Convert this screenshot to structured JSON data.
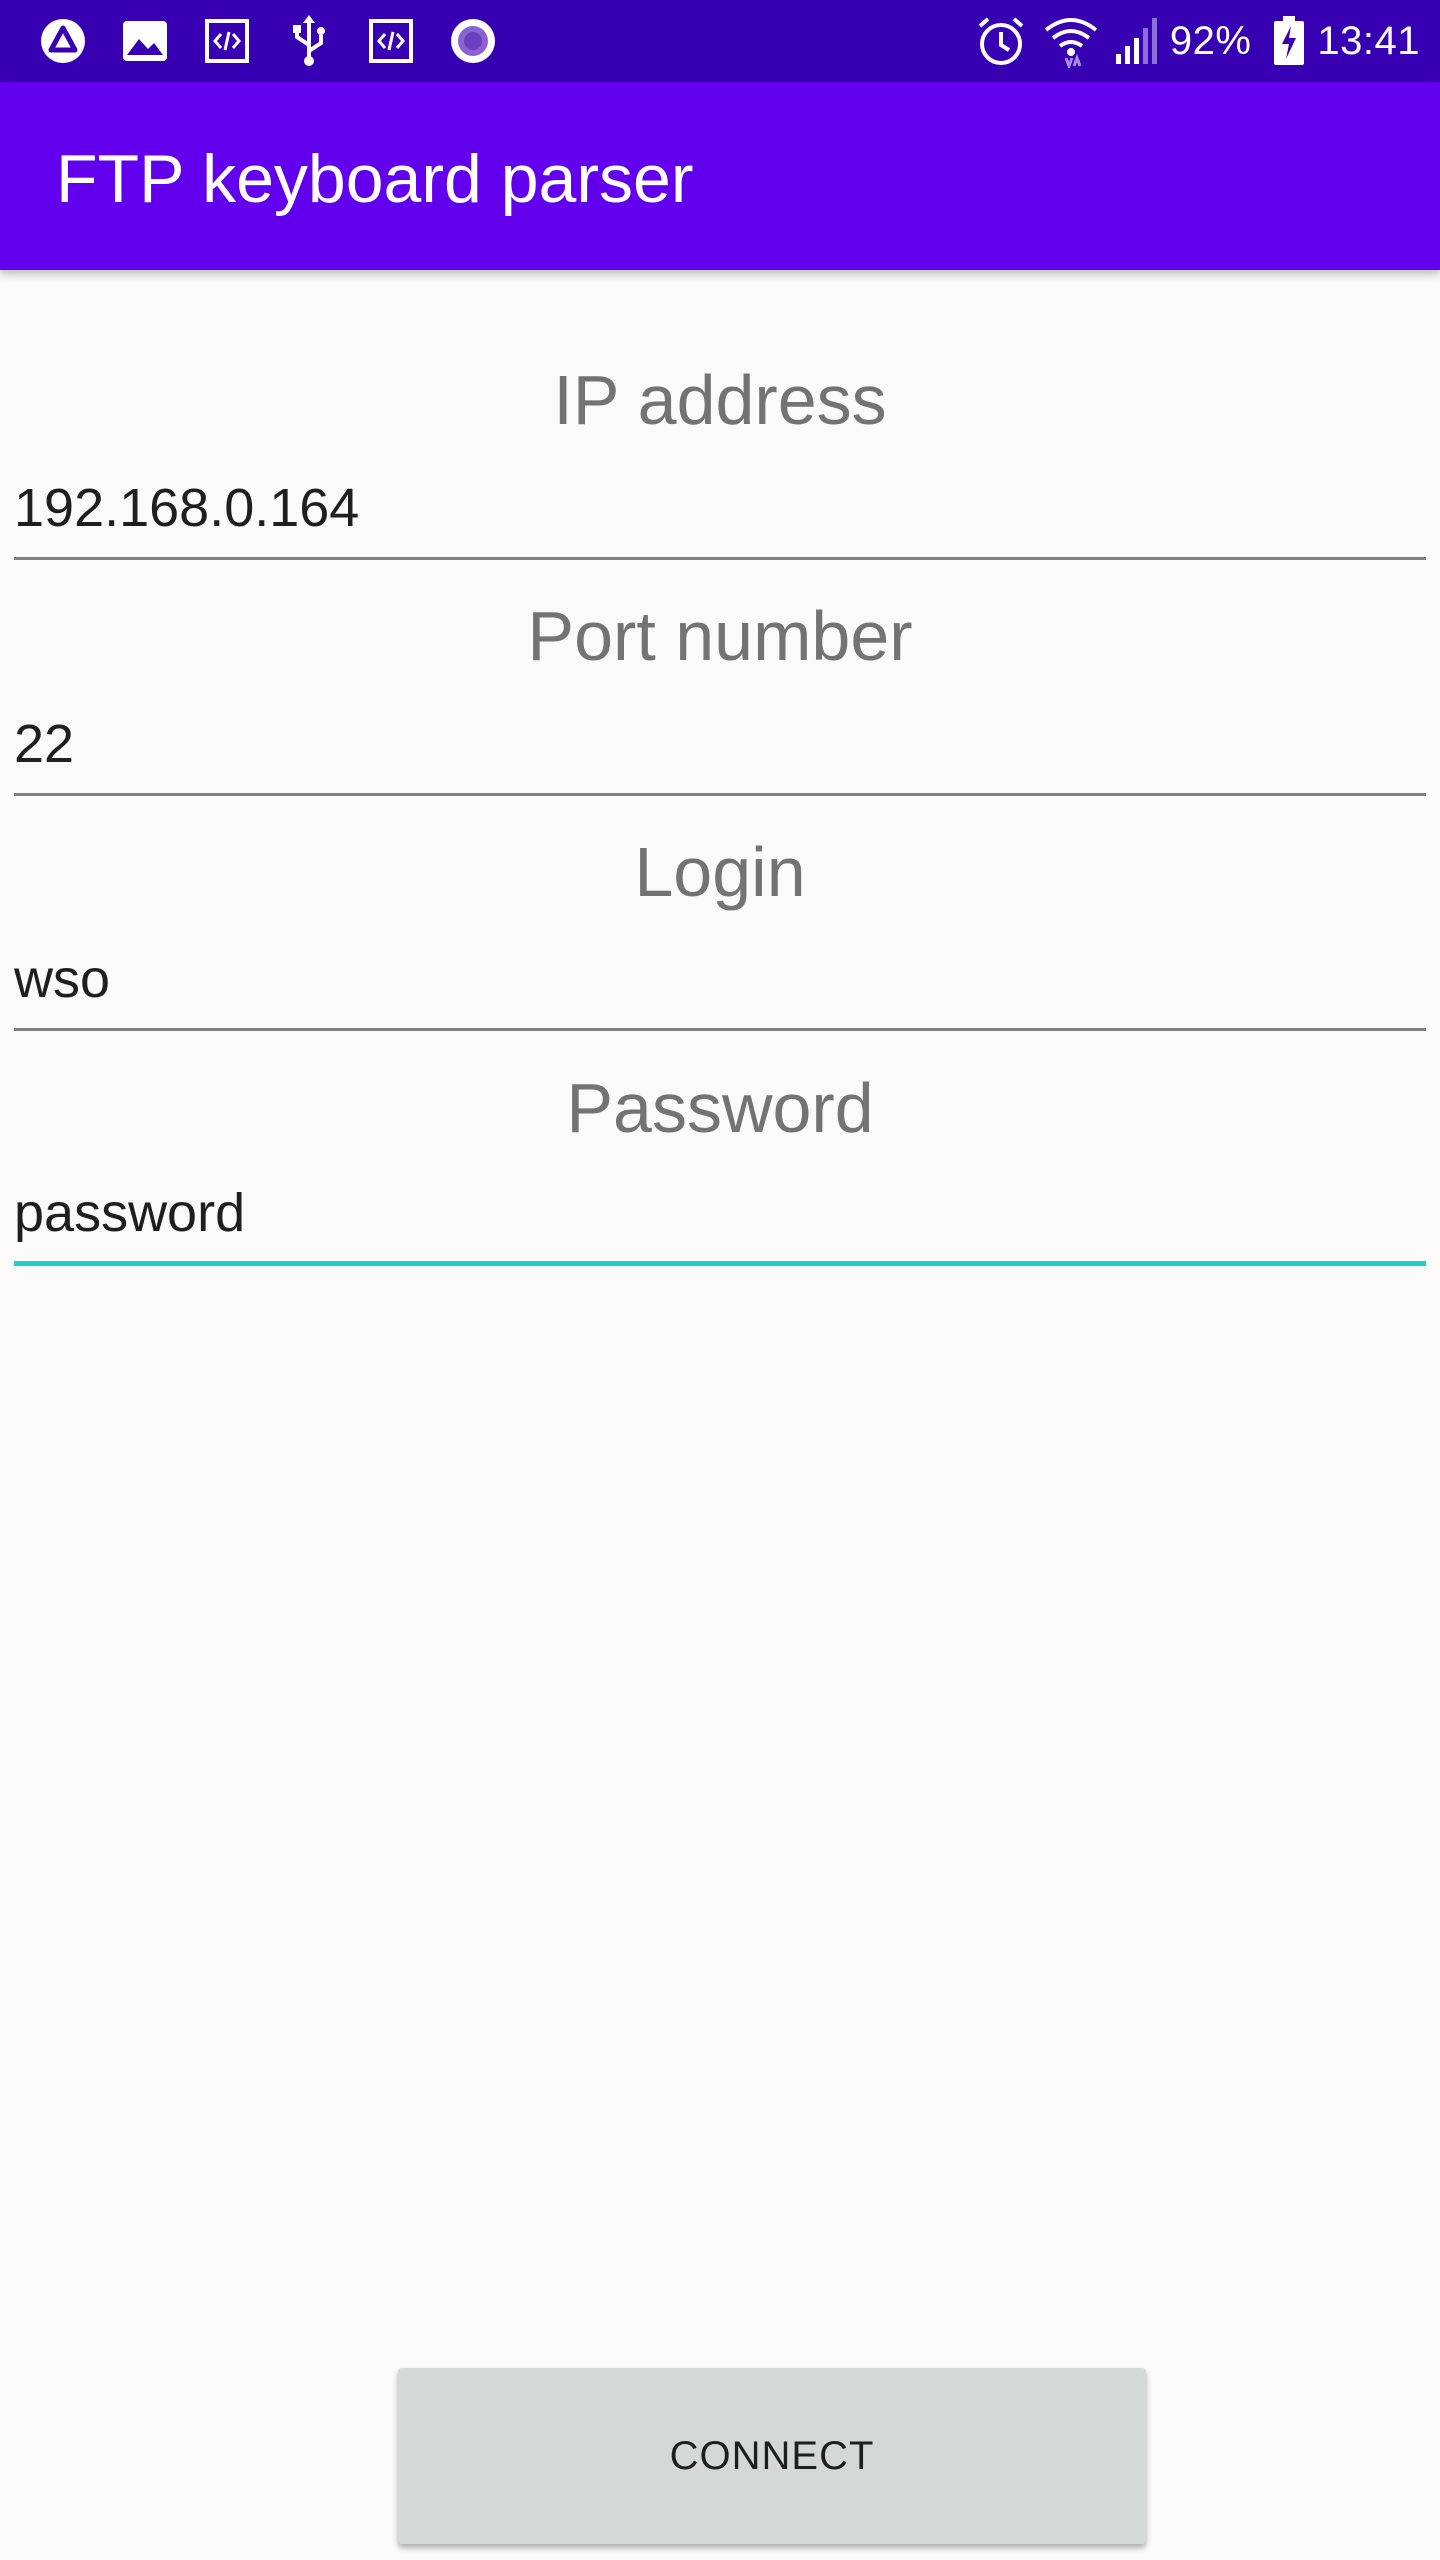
{
  "status_bar": {
    "left_icons": [
      "app-a-icon",
      "image-icon",
      "code-icon",
      "usb-icon",
      "code-icon",
      "record-icon"
    ],
    "battery_percent": "92%",
    "time": "13:41"
  },
  "app_bar": {
    "title": "FTP keyboard parser"
  },
  "form": {
    "ip": {
      "label": "IP address",
      "value": "192.168.0.164"
    },
    "port": {
      "label": "Port number",
      "value": "22"
    },
    "login": {
      "label": "Login",
      "value": "wso"
    },
    "password": {
      "label": "Password",
      "value": "password"
    }
  },
  "connect_label": "CONNECT",
  "colors": {
    "status_bar": "#3700b3",
    "app_bar": "#6200ee",
    "focus_underline": "#1cd3c0",
    "button": "#d6d7d7"
  }
}
